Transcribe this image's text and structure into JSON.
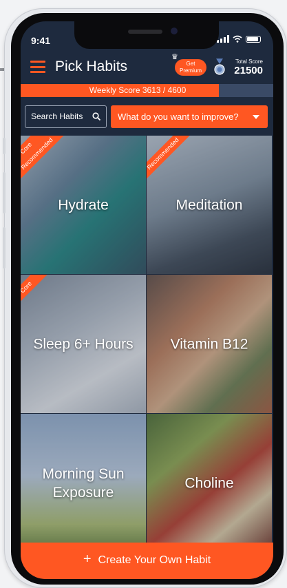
{
  "status_bar": {
    "time": "9:41"
  },
  "header": {
    "title": "Pick Habits",
    "premium_line1": "Get",
    "premium_line2": "Premium",
    "total_score_label": "Total Score",
    "total_score_value": "21500"
  },
  "weekly_score": {
    "label": "Weekly Score  3613 / 4600",
    "current": 3613,
    "max": 4600
  },
  "search": {
    "placeholder": "Search Habits"
  },
  "improve_dropdown": {
    "label": "What do you want to improve?"
  },
  "habits": [
    {
      "name": "Hydrate",
      "badge_core": "Core",
      "badge_recommended": "Recommended"
    },
    {
      "name": "Meditation",
      "badge_recommended": "Recommended"
    },
    {
      "name": "Sleep 6+ Hours",
      "badge_core": "Core"
    },
    {
      "name": "Vitamin B12"
    },
    {
      "name": "Morning Sun Exposure"
    },
    {
      "name": "Choline"
    }
  ],
  "create_button": {
    "label": "Create Your Own Habit"
  },
  "colors": {
    "accent": "#ff5722",
    "background": "#1e2a3e"
  },
  "icons": [
    "menu-icon",
    "crown-icon",
    "medal-icon",
    "search-icon",
    "chevron-down-icon",
    "plus-icon"
  ]
}
